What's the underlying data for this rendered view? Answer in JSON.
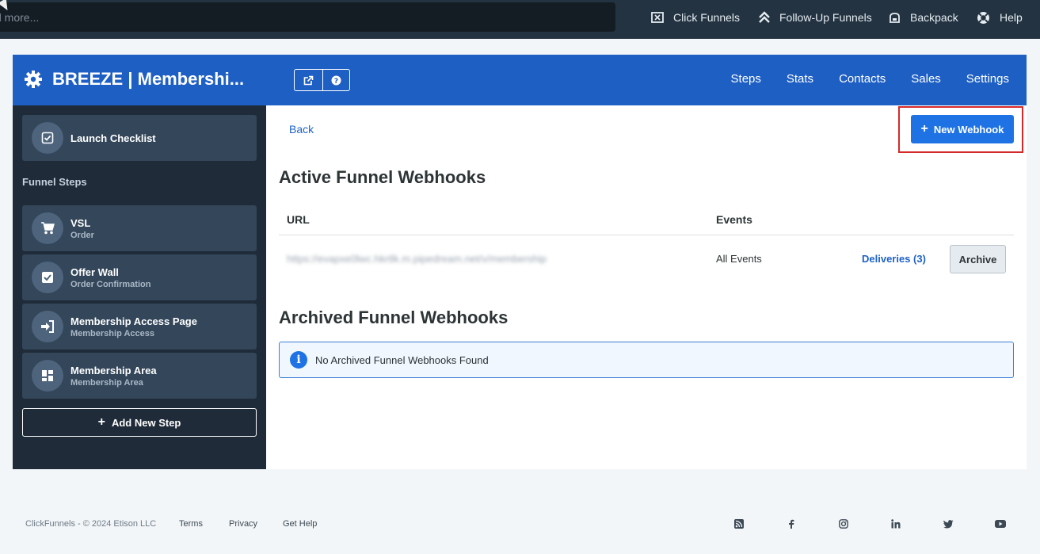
{
  "topnav": {
    "search_placeholder": "d more...",
    "items": [
      {
        "label": "Click Funnels",
        "icon": "click-funnels-icon"
      },
      {
        "label": "Follow-Up Funnels",
        "icon": "chevrons-up-icon"
      },
      {
        "label": "Backpack",
        "icon": "backpack-icon"
      },
      {
        "label": "Help",
        "icon": "lifebuoy-icon"
      }
    ]
  },
  "header": {
    "title": "BREEZE | Membershi...",
    "nav": [
      "Steps",
      "Stats",
      "Contacts",
      "Sales",
      "Settings"
    ]
  },
  "sidebar": {
    "launch_checklist": "Launch Checklist",
    "funnel_steps_label": "Funnel Steps",
    "steps": [
      {
        "name": "VSL",
        "type": "Order",
        "icon": "cart-icon"
      },
      {
        "name": "Offer Wall",
        "type": "Order Confirmation",
        "icon": "checkbox-icon"
      },
      {
        "name": "Membership Access Page",
        "type": "Membership Access",
        "icon": "sign-in-icon"
      },
      {
        "name": "Membership Area",
        "type": "Membership Area",
        "icon": "dashboard-icon"
      }
    ],
    "add_step": "Add New Step"
  },
  "main": {
    "back": "Back",
    "new_webhook": "New Webhook",
    "active_title": "Active Funnel Webhooks",
    "columns": {
      "url": "URL",
      "events": "Events"
    },
    "rows": [
      {
        "url": "https://evapxe0lwc.hkrtlk.m.pipedream.net/v/membership",
        "events": "All Events",
        "deliveries": "Deliveries (3)",
        "archive": "Archive"
      }
    ],
    "archived_title": "Archived Funnel Webhooks",
    "archived_empty": "No Archived Funnel Webhooks Found"
  },
  "footer": {
    "copyright": "ClickFunnels - © 2024 Etison LLC",
    "links": [
      "Terms",
      "Privacy",
      "Get Help"
    ],
    "social": [
      "rss-icon",
      "facebook-icon",
      "instagram-icon",
      "linkedin-icon",
      "twitter-icon",
      "youtube-icon"
    ]
  },
  "colors": {
    "topnav_bg": "#233341",
    "header_bg": "#1e5fc4",
    "sidebar_bg": "#1f2b38",
    "step_bg": "#33465a",
    "primary_button": "#1e72e4",
    "link": "#1e63c7",
    "highlight": "#d62a2a"
  }
}
